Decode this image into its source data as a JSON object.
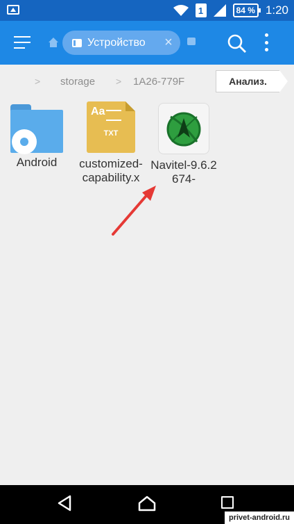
{
  "status_bar": {
    "battery": "84 %",
    "sim_slot": "1",
    "time": "1:20"
  },
  "toolbar": {
    "location_chip": "Устройство",
    "close_symbol": "×"
  },
  "breadcrumb": {
    "items": [
      "storage",
      "1A26-779F"
    ],
    "analyze_button": "Анализ."
  },
  "files": [
    {
      "name": "Android",
      "icon": "folder-gear-icon"
    },
    {
      "name": "customized-capability.x",
      "icon": "txt-file-icon",
      "icon_text": "Aa",
      "icon_label": "TXT"
    },
    {
      "name": "Navitel-9.6.2674-",
      "icon": "navitel-app-icon"
    }
  ],
  "watermark": "privet-android.ru",
  "colors": {
    "status_bar": "#1565c0",
    "toolbar": "#1e88e5",
    "chip": "#64a9ee",
    "arrow": "#e53935"
  }
}
